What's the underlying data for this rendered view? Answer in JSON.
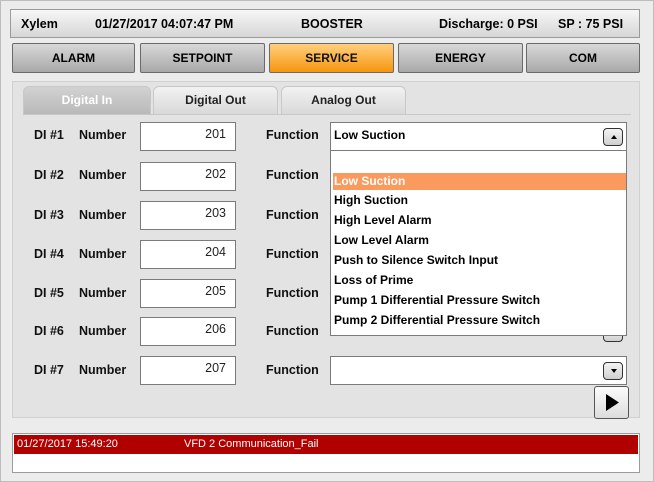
{
  "header": {
    "brand": "Xylem",
    "datetime": "01/27/2017 04:07:47 PM",
    "mode": "BOOSTER",
    "discharge": "Discharge: 0 PSI",
    "setpoint": "SP : 75 PSI"
  },
  "nav": {
    "items": [
      {
        "label": "ALARM"
      },
      {
        "label": "SETPOINT"
      },
      {
        "label": "SERVICE"
      },
      {
        "label": "ENERGY"
      },
      {
        "label": "COM"
      }
    ],
    "active": "SERVICE"
  },
  "tabs": {
    "items": [
      {
        "label": "Digital In"
      },
      {
        "label": "Digital Out"
      },
      {
        "label": "Analog Out"
      }
    ],
    "active": "Digital In"
  },
  "rows": [
    {
      "id": "DI #1",
      "number_label": "Number",
      "number": "201",
      "function_label": "Function",
      "function_value": "Low Suction"
    },
    {
      "id": "DI #2",
      "number_label": "Number",
      "number": "202",
      "function_label": "Function",
      "function_value": ""
    },
    {
      "id": "DI #3",
      "number_label": "Number",
      "number": "203",
      "function_label": "Function",
      "function_value": ""
    },
    {
      "id": "DI #4",
      "number_label": "Number",
      "number": "204",
      "function_label": "Function",
      "function_value": ""
    },
    {
      "id": "DI #5",
      "number_label": "Number",
      "number": "205",
      "function_label": "Function",
      "function_value": ""
    },
    {
      "id": "DI #6",
      "number_label": "Number",
      "number": "206",
      "function_label": "Function",
      "function_value": ""
    },
    {
      "id": "DI #7",
      "number_label": "Number",
      "number": "207",
      "function_label": "Function",
      "function_value": ""
    }
  ],
  "dropdown": {
    "open": true,
    "selected": "Low Suction",
    "options": [
      "Low Suction",
      "High Suction",
      "High Level Alarm",
      "Low Level Alarm",
      "Push to Silence Switch Input",
      "Loss of Prime",
      "Pump 1 Differential Pressure Switch",
      "Pump 2 Differential Pressure Switch"
    ]
  },
  "alarm": {
    "timestamp": "01/27/2017 15:49:20",
    "message": "VFD 2 Communication_Fail"
  },
  "colors": {
    "active_nav": "#f5960e",
    "selected_option": "#fb9a5f",
    "alarm_bar": "#b00000"
  },
  "icons": {
    "dropdown": "chevron-up-icon / chevron-down-icon",
    "next": "play-icon"
  }
}
